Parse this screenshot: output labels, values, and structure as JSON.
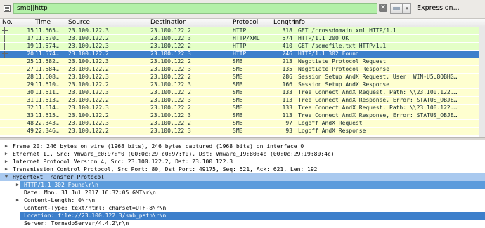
{
  "filter": {
    "value": "smb||http",
    "clear_glyph": "✕",
    "dropdown_glyph": "▾",
    "expression_label": "Expression...",
    "input_color": "#b3f0a8"
  },
  "packet_list": {
    "columns": [
      "No.",
      "Time",
      "Source",
      "Destination",
      "Protocol",
      "Length",
      "Info"
    ],
    "rows": [
      {
        "no": "15",
        "time": "11.565…",
        "src": "23.100.122.3",
        "dst": "23.100.122.2",
        "proto": "HTTP",
        "len": "318",
        "info": "GET /crossdomain.xml HTTP/1.1",
        "bg": "#e4ffc7",
        "selected": false
      },
      {
        "no": "17",
        "time": "11.570…",
        "src": "23.100.122.2",
        "dst": "23.100.122.3",
        "proto": "HTTP/XML",
        "len": "574",
        "info": "HTTP/1.1 200 OK",
        "bg": "#e4ffc7",
        "selected": false
      },
      {
        "no": "19",
        "time": "11.574…",
        "src": "23.100.122.3",
        "dst": "23.100.122.2",
        "proto": "HTTP",
        "len": "410",
        "info": "GET /somefile.txt HTTP/1.1",
        "bg": "#e4ffc7",
        "selected": false
      },
      {
        "no": "20",
        "time": "11.574…",
        "src": "23.100.122.2",
        "dst": "23.100.122.3",
        "proto": "HTTP",
        "len": "246",
        "info": "HTTP/1.1 302 Found",
        "bg": "#3d7fcb",
        "selected": true
      },
      {
        "no": "25",
        "time": "11.582…",
        "src": "23.100.122.3",
        "dst": "23.100.122.2",
        "proto": "SMB",
        "len": "213",
        "info": "Negotiate Protocol Request",
        "bg": "#feffd0",
        "selected": false
      },
      {
        "no": "27",
        "time": "11.584…",
        "src": "23.100.122.2",
        "dst": "23.100.122.3",
        "proto": "SMB",
        "len": "135",
        "info": "Negotiate Protocol Response",
        "bg": "#feffd0",
        "selected": false
      },
      {
        "no": "28",
        "time": "11.608…",
        "src": "23.100.122.3",
        "dst": "23.100.122.2",
        "proto": "SMB",
        "len": "286",
        "info": "Session Setup AndX Request, User: WIN-U5U8QBHG…",
        "bg": "#feffd0",
        "selected": false
      },
      {
        "no": "29",
        "time": "11.610…",
        "src": "23.100.122.2",
        "dst": "23.100.122.3",
        "proto": "SMB",
        "len": "166",
        "info": "Session Setup AndX Response",
        "bg": "#feffd0",
        "selected": false
      },
      {
        "no": "30",
        "time": "11.611…",
        "src": "23.100.122.3",
        "dst": "23.100.122.2",
        "proto": "SMB",
        "len": "133",
        "info": "Tree Connect AndX Request, Path: \\\\23.100.122.…",
        "bg": "#feffd0",
        "selected": false
      },
      {
        "no": "31",
        "time": "11.613…",
        "src": "23.100.122.2",
        "dst": "23.100.122.3",
        "proto": "SMB",
        "len": "113",
        "info": "Tree Connect AndX Response, Error: STATUS_OBJE…",
        "bg": "#feffd0",
        "selected": false
      },
      {
        "no": "32",
        "time": "11.614…",
        "src": "23.100.122.3",
        "dst": "23.100.122.2",
        "proto": "SMB",
        "len": "133",
        "info": "Tree Connect AndX Request, Path: \\\\23.100.122.…",
        "bg": "#feffd0",
        "selected": false
      },
      {
        "no": "33",
        "time": "11.615…",
        "src": "23.100.122.2",
        "dst": "23.100.122.3",
        "proto": "SMB",
        "len": "113",
        "info": "Tree Connect AndX Response, Error: STATUS_OBJE…",
        "bg": "#feffd0",
        "selected": false
      },
      {
        "no": "48",
        "time": "22.343…",
        "src": "23.100.122.3",
        "dst": "23.100.122.2",
        "proto": "SMB",
        "len": "97",
        "info": "Logoff AndX Request",
        "bg": "#feffd0",
        "selected": false
      },
      {
        "no": "49",
        "time": "22.346…",
        "src": "23.100.122.2",
        "dst": "23.100.122.3",
        "proto": "SMB",
        "len": "93",
        "info": "Logoff AndX Response",
        "bg": "#feffd0",
        "selected": false
      }
    ]
  },
  "detail": {
    "rows": [
      {
        "level": 0,
        "arrow": "▶",
        "text": "Frame 20: 246 bytes on wire (1968 bits), 246 bytes captured (1968 bits) on interface 0",
        "highlight": ""
      },
      {
        "level": 0,
        "arrow": "▶",
        "text": "Ethernet II, Src: Vmware_c0:97:f0 (00:0c:29:c0:97:f0), Dst: Vmware_19:80:4c (00:0c:29:19:80:4c)",
        "highlight": ""
      },
      {
        "level": 0,
        "arrow": "▶",
        "text": "Internet Protocol Version 4, Src: 23.100.122.2, Dst: 23.100.122.3",
        "highlight": ""
      },
      {
        "level": 0,
        "arrow": "▶",
        "text": "Transmission Control Protocol, Src Port: 80, Dst Port: 49175, Seq: 521, Ack: 621, Len: 192",
        "highlight": ""
      },
      {
        "level": 0,
        "arrow": "▼",
        "text": "Hypertext Transfer Protocol",
        "highlight": "#a9c9ef"
      },
      {
        "level": 1,
        "arrow": "▶",
        "text": "HTTP/1.1 302 Found\\r\\n",
        "highlight": "#5b9bdc"
      },
      {
        "level": 1,
        "arrow": "",
        "text": "Date: Mon, 31 Jul 2017 16:32:05 GMT\\r\\n",
        "highlight": ""
      },
      {
        "level": 1,
        "arrow": "▶",
        "text": "Content-Length: 0\\r\\n",
        "highlight": ""
      },
      {
        "level": 1,
        "arrow": "",
        "text": "Content-Type: text/html; charset=UTF-8\\r\\n",
        "highlight": ""
      },
      {
        "level": 1,
        "arrow": "",
        "text": "Location: file://23.100.122.3/smb_path\\r\\n",
        "highlight": "#3d7fcb"
      },
      {
        "level": 1,
        "arrow": "",
        "text": "Server: TornadoServer/4.4.2\\r\\n",
        "highlight": ""
      }
    ]
  }
}
